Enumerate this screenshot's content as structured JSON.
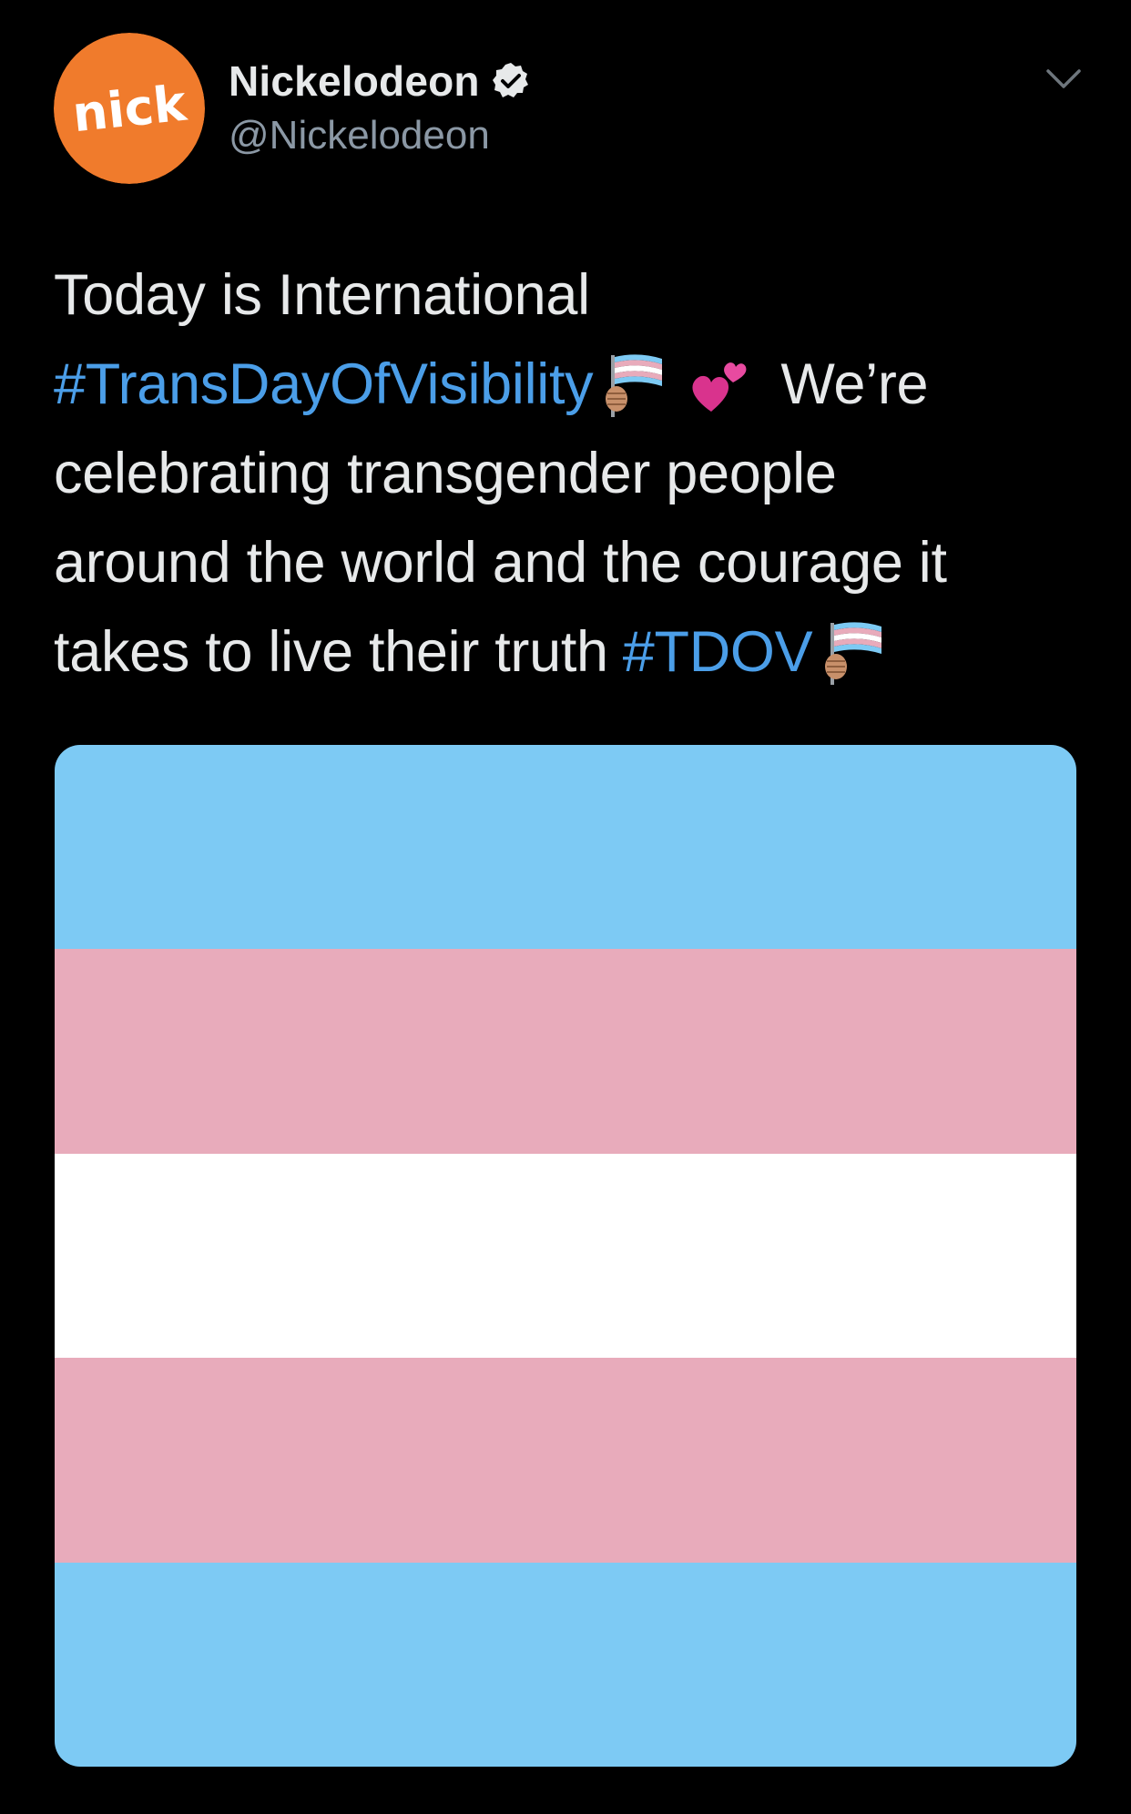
{
  "account": {
    "display_name": "Nickelodeon",
    "handle": "@Nickelodeon",
    "verified": true,
    "avatar": {
      "logo_text": "nick",
      "bg_color": "#f07b2c",
      "logo_color": "#ffffff"
    }
  },
  "menu": {
    "icon": "chevron-down-icon"
  },
  "tweet": {
    "line1": "Today is International",
    "hashtag1": "#TransDayOfVisibility",
    "were": "We’re",
    "line3": "celebrating transgender people",
    "line4": "around the world and the courage it",
    "line5_text": "takes to live their truth",
    "hashtag2": "#TDOV",
    "emojis": [
      "transgender-flag-icon",
      "two-hearts-icon"
    ]
  },
  "media": {
    "description_icon": "transgender-flag",
    "stripe_colors": [
      "#7dcaf4",
      "#e8abbb",
      "#ffffff",
      "#e8abbb",
      "#7dcaf4"
    ]
  },
  "colors": {
    "background": "#000000",
    "text": "#e7e9ea",
    "secondary": "#8b98a5",
    "link": "#4b9ee8"
  }
}
